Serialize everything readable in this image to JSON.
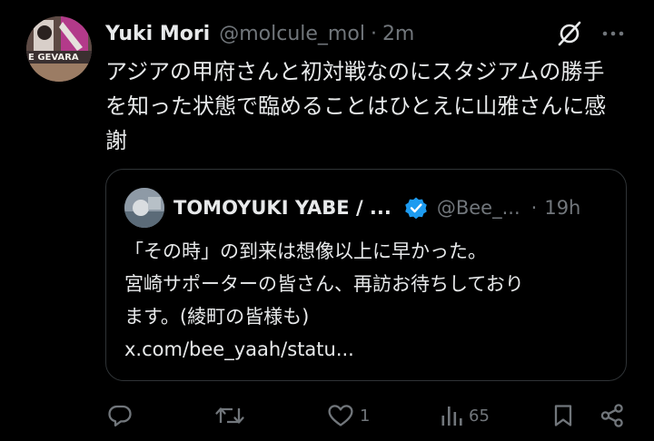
{
  "author": {
    "display_name": "Yuki Mori",
    "handle": "@molcule_mol",
    "separator": "·",
    "time": "2m",
    "avatar_text": "E GEVARA"
  },
  "tweet": {
    "text": "アジアの甲府さんと初対戦なのにスタジアムの勝手\nを知った状態で臨めることはひとえに山雅さんに感\n謝"
  },
  "quote": {
    "display_name": "TOMOYUKI YABE / ...",
    "handle": "@Bee_...",
    "separator": "·",
    "time": "19h",
    "text": "「その時」の到来は想像以上に早かった。\n宮崎サポーターの皆さん、再訪お待ちしており\nます。(綾町の皆様も)\nx.com/bee_yaah/statu..."
  },
  "actions": {
    "reply": {
      "icon": "reply-icon"
    },
    "retweet": {
      "icon": "retweet-icon"
    },
    "like": {
      "icon": "heart-icon",
      "count": "1"
    },
    "views": {
      "icon": "views-icon",
      "count": "65"
    },
    "bookmark": {
      "icon": "bookmark-icon"
    },
    "share": {
      "icon": "share-icon"
    }
  },
  "colors": {
    "background": "#000000",
    "text": "#e7e9ea",
    "muted": "#71767b",
    "border": "#2f3336",
    "verified": "#1d9bf0"
  }
}
